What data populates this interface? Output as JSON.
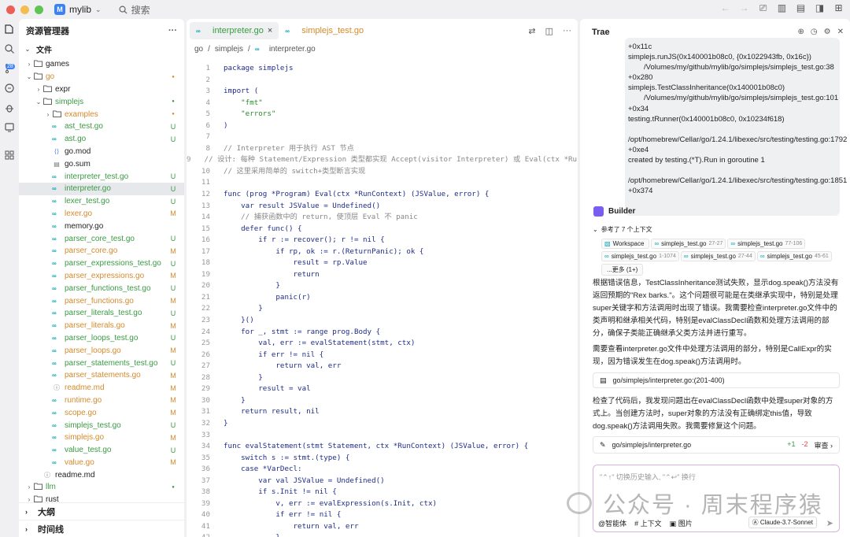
{
  "titlebar": {
    "project": "mylib",
    "project_icon": "M",
    "search_label": "搜索"
  },
  "explorer": {
    "title": "资源管理器",
    "section_files": "文件",
    "rows": [
      {
        "depth": 0,
        "type": "folder",
        "name": "games",
        "chev": "›",
        "status": "",
        "color": ""
      },
      {
        "depth": 0,
        "type": "folder",
        "name": "go",
        "chev": "⌄",
        "status": "●",
        "color": "orange"
      },
      {
        "depth": 1,
        "type": "folder",
        "name": "expr",
        "chev": "›",
        "status": "",
        "color": ""
      },
      {
        "depth": 1,
        "type": "folder",
        "name": "simplejs",
        "chev": "⌄",
        "status": "●",
        "color": "green"
      },
      {
        "depth": 2,
        "type": "folder",
        "name": "examples",
        "chev": "›",
        "status": "●",
        "color": "orange"
      },
      {
        "depth": 2,
        "type": "go",
        "name": "ast_test.go",
        "chev": "",
        "status": "U",
        "color": "green"
      },
      {
        "depth": 2,
        "type": "go",
        "name": "ast.go",
        "chev": "",
        "status": "U",
        "color": "green"
      },
      {
        "depth": 2,
        "type": "mod",
        "name": "go.mod",
        "chev": "",
        "status": "",
        "color": ""
      },
      {
        "depth": 2,
        "type": "sum",
        "name": "go.sum",
        "chev": "",
        "status": "",
        "color": ""
      },
      {
        "depth": 2,
        "type": "go",
        "name": "interpreter_test.go",
        "chev": "",
        "status": "U",
        "color": "green"
      },
      {
        "depth": 2,
        "type": "go",
        "name": "interpreter.go",
        "chev": "",
        "status": "U",
        "color": "green",
        "selected": true
      },
      {
        "depth": 2,
        "type": "go",
        "name": "lexer_test.go",
        "chev": "",
        "status": "U",
        "color": "green"
      },
      {
        "depth": 2,
        "type": "go",
        "name": "lexer.go",
        "chev": "",
        "status": "M",
        "color": "orange"
      },
      {
        "depth": 2,
        "type": "go",
        "name": "memory.go",
        "chev": "",
        "status": "",
        "color": ""
      },
      {
        "depth": 2,
        "type": "go",
        "name": "parser_core_test.go",
        "chev": "",
        "status": "U",
        "color": "green"
      },
      {
        "depth": 2,
        "type": "go",
        "name": "parser_core.go",
        "chev": "",
        "status": "M",
        "color": "orange"
      },
      {
        "depth": 2,
        "type": "go",
        "name": "parser_expressions_test.go",
        "chev": "",
        "status": "U",
        "color": "green"
      },
      {
        "depth": 2,
        "type": "go",
        "name": "parser_expressions.go",
        "chev": "",
        "status": "M",
        "color": "orange"
      },
      {
        "depth": 2,
        "type": "go",
        "name": "parser_functions_test.go",
        "chev": "",
        "status": "U",
        "color": "green"
      },
      {
        "depth": 2,
        "type": "go",
        "name": "parser_functions.go",
        "chev": "",
        "status": "M",
        "color": "orange"
      },
      {
        "depth": 2,
        "type": "go",
        "name": "parser_literals_test.go",
        "chev": "",
        "status": "U",
        "color": "green"
      },
      {
        "depth": 2,
        "type": "go",
        "name": "parser_literals.go",
        "chev": "",
        "status": "M",
        "color": "orange"
      },
      {
        "depth": 2,
        "type": "go",
        "name": "parser_loops_test.go",
        "chev": "",
        "status": "U",
        "color": "green"
      },
      {
        "depth": 2,
        "type": "go",
        "name": "parser_loops.go",
        "chev": "",
        "status": "M",
        "color": "orange"
      },
      {
        "depth": 2,
        "type": "go",
        "name": "parser_statements_test.go",
        "chev": "",
        "status": "U",
        "color": "green"
      },
      {
        "depth": 2,
        "type": "go",
        "name": "parser_statements.go",
        "chev": "",
        "status": "M",
        "color": "orange"
      },
      {
        "depth": 2,
        "type": "md",
        "name": "readme.md",
        "chev": "",
        "status": "M",
        "color": "orange"
      },
      {
        "depth": 2,
        "type": "go",
        "name": "runtime.go",
        "chev": "",
        "status": "M",
        "color": "orange"
      },
      {
        "depth": 2,
        "type": "go",
        "name": "scope.go",
        "chev": "",
        "status": "M",
        "color": "orange"
      },
      {
        "depth": 2,
        "type": "go",
        "name": "simplejs_test.go",
        "chev": "",
        "status": "U",
        "color": "green"
      },
      {
        "depth": 2,
        "type": "go",
        "name": "simplejs.go",
        "chev": "",
        "status": "M",
        "color": "orange"
      },
      {
        "depth": 2,
        "type": "go",
        "name": "value_test.go",
        "chev": "",
        "status": "U",
        "color": "green"
      },
      {
        "depth": 2,
        "type": "go",
        "name": "value.go",
        "chev": "",
        "status": "M",
        "color": "orange"
      },
      {
        "depth": 1,
        "type": "md",
        "name": "readme.md",
        "chev": "",
        "status": "",
        "color": ""
      },
      {
        "depth": 0,
        "type": "folder",
        "name": "llm",
        "chev": "›",
        "status": "●",
        "color": "green"
      },
      {
        "depth": 0,
        "type": "folder",
        "name": "rust",
        "chev": "›",
        "status": "",
        "color": ""
      }
    ],
    "section_outline": "大纲",
    "section_timeline": "时间线"
  },
  "editor": {
    "tabs": [
      {
        "label": "interpreter.go",
        "active": true,
        "close": "×"
      },
      {
        "label": "simplejs_test.go",
        "active": false,
        "close": ""
      }
    ],
    "breadcrumbs": [
      "go",
      "simplejs",
      "interpreter.go"
    ],
    "lines": [
      {
        "n": "1",
        "code": "package simplejs"
      },
      {
        "n": "2",
        "code": ""
      },
      {
        "n": "3",
        "code": "import ("
      },
      {
        "n": "4",
        "code": "    \"fmt\""
      },
      {
        "n": "5",
        "code": "    \"errors\""
      },
      {
        "n": "6",
        "code": ")"
      },
      {
        "n": "7",
        "code": ""
      },
      {
        "n": "8",
        "code": "// Interpreter 用于执行 AST 节点"
      },
      {
        "n": "9",
        "code": "// 设计: 每种 Statement/Expression 类型都实现 Accept(visitor Interpreter) 或 Eval(ctx *RunCo"
      },
      {
        "n": "10",
        "code": "// 这里采用简单的 switch+类型断言实现"
      },
      {
        "n": "11",
        "code": ""
      },
      {
        "n": "12",
        "code": "func (prog *Program) Eval(ctx *RunContext) (JSValue, error) {"
      },
      {
        "n": "13",
        "code": "    var result JSValue = Undefined()"
      },
      {
        "n": "14",
        "code": "    // 捕获函数中的 return, 使顶层 Eval 不 panic"
      },
      {
        "n": "15",
        "code": "    defer func() {"
      },
      {
        "n": "16",
        "code": "        if r := recover(); r != nil {"
      },
      {
        "n": "17",
        "code": "            if rp, ok := r.(ReturnPanic); ok {"
      },
      {
        "n": "18",
        "code": "                result = rp.Value"
      },
      {
        "n": "19",
        "code": "                return"
      },
      {
        "n": "20",
        "code": "            }"
      },
      {
        "n": "21",
        "code": "            panic(r)"
      },
      {
        "n": "22",
        "code": "        }"
      },
      {
        "n": "23",
        "code": "    }()"
      },
      {
        "n": "24",
        "code": "    for _, stmt := range prog.Body {"
      },
      {
        "n": "25",
        "code": "        val, err := evalStatement(stmt, ctx)"
      },
      {
        "n": "26",
        "code": "        if err != nil {"
      },
      {
        "n": "27",
        "code": "            return val, err"
      },
      {
        "n": "28",
        "code": "        }"
      },
      {
        "n": "29",
        "code": "        result = val"
      },
      {
        "n": "30",
        "code": "    }"
      },
      {
        "n": "31",
        "code": "    return result, nil"
      },
      {
        "n": "32",
        "code": "}"
      },
      {
        "n": "33",
        "code": ""
      },
      {
        "n": "34",
        "code": "func evalStatement(stmt Statement, ctx *RunContext) (JSValue, error) {"
      },
      {
        "n": "35",
        "code": "    switch s := stmt.(type) {"
      },
      {
        "n": "36",
        "code": "    case *VarDecl:"
      },
      {
        "n": "37",
        "code": "        var val JSValue = Undefined()"
      },
      {
        "n": "38",
        "code": "        if s.Init != nil {"
      },
      {
        "n": "39",
        "code": "            v, err := evalExpression(s.Init, ctx)"
      },
      {
        "n": "40",
        "code": "            if err != nil {"
      },
      {
        "n": "41",
        "code": "                return val, err"
      },
      {
        "n": "42",
        "code": "            }"
      }
    ]
  },
  "trae": {
    "title": "Trae",
    "log_lines": [
      {
        "text": "+0x11c",
        "indent": false
      },
      {
        "text": "simplejs.runJS(0x140001b08c0, {0x1022943fb, 0x16c})",
        "indent": false
      },
      {
        "text": "/Volumes/my/github/mylib/go/simplejs/simplejs_test.go:38",
        "indent": true
      },
      {
        "text": "+0x280",
        "indent": false
      },
      {
        "text": "simplejs.TestClassInheritance(0x140001b08c0)",
        "indent": false
      },
      {
        "text": "/Volumes/my/github/mylib/go/simplejs/simplejs_test.go:101",
        "indent": true
      },
      {
        "text": "+0x34",
        "indent": false
      },
      {
        "text": "testing.tRunner(0x140001b08c0, 0x10234f618)",
        "indent": false
      },
      {
        "text": "",
        "indent": false
      },
      {
        "text": "/opt/homebrew/Cellar/go/1.24.1/libexec/src/testing/testing.go:1792",
        "indent": false
      },
      {
        "text": "+0xe4",
        "indent": false
      },
      {
        "text": "created by testing.(*T).Run in goroutine 1",
        "indent": false
      },
      {
        "text": "",
        "indent": false
      },
      {
        "text": "/opt/homebrew/Cellar/go/1.24.1/libexec/src/testing/testing.go:1851",
        "indent": false
      },
      {
        "text": "+0x374",
        "indent": false
      }
    ],
    "builder_label": "Builder",
    "context_label": "参考了 7 个上下文",
    "chips": [
      {
        "name": "Workspace",
        "range": ""
      },
      {
        "name": "simplejs_test.go",
        "range": "27-27"
      },
      {
        "name": "simplejs_test.go",
        "range": "77-106"
      },
      {
        "name": "simplejs_test.go",
        "range": "1-1074"
      },
      {
        "name": "simplejs_test.go",
        "range": "27-44"
      },
      {
        "name": "simplejs_test.go",
        "range": "45-61"
      },
      {
        "name": "...更多 (1+)",
        "range": ""
      }
    ],
    "para1": "根据错误信息，TestClassInheritance测试失败，显示dog.speak()方法没有返回预期的\"Rex barks.\"。这个问题很可能是在类继承实现中，特别是处理super关键字和方法调用时出现了错误。我需要检查interpreter.go文件中的类声明和继承相关代码，特别是evalClassDecl函数和处理方法调用的部分，确保子类能正确继承父类方法并进行重写。",
    "para2": "需要查看interpreter.go文件中处理方法调用的部分，特别是CallExpr的实现，因为错误发生在dog.speak()方法调用时。",
    "fileref1": "go/simplejs/interpreter.go",
    "fileref1_range": ":(201-400)",
    "para3": "检查了代码后，我发现问题出在evalClassDecl函数中处理super对象的方式上。当创建方法时，super对象的方法没有正确绑定this值，导致dog.speak()方法调用失败。我需要修复这个问题。",
    "fileref2": "go/simplejs/interpreter.go",
    "diff_add": "+1",
    "diff_del": "-2",
    "review_label": "审查",
    "input_placeholder": "\"⌃↑\" 切换历史输入, \"⌃↩\" 换行",
    "agent_label": "@智能体",
    "context_btn": "# 上下文",
    "image_btn": "图片",
    "model": "Claude-3.7-Sonnet"
  },
  "watermark": "公众号 · 周末程序猿",
  "colors": {
    "accent": "#3b82f6",
    "added": "#3a9a43",
    "modified": "#d58a2b",
    "go": "#0aa5b5"
  }
}
